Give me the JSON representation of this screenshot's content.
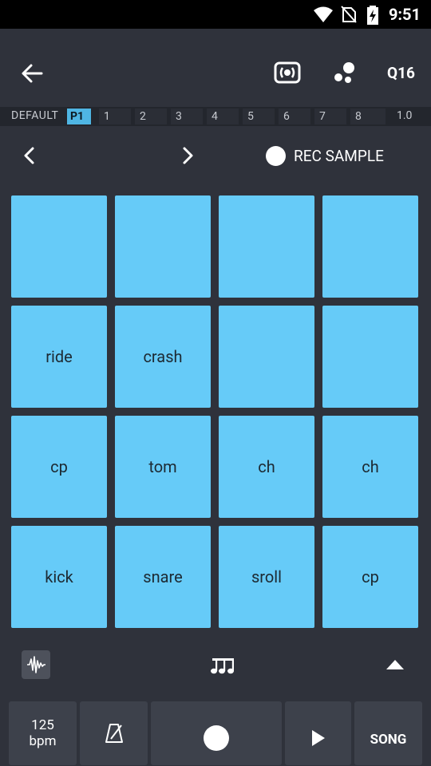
{
  "status_bar": {
    "time": "9:51"
  },
  "app_bar": {
    "quantize_label": "Q16"
  },
  "pattern_strip": {
    "default_label": "DEFAULT",
    "cells": [
      "P1",
      "1",
      "2",
      "3",
      "4",
      "5",
      "6",
      "7",
      "8"
    ],
    "active_cell": "P1",
    "speed": "1.0"
  },
  "page_nav": {
    "rec_sample_label": "REC SAMPLE"
  },
  "pads": {
    "row1": [
      "",
      "",
      "",
      ""
    ],
    "row2": [
      "ride",
      "crash",
      "",
      ""
    ],
    "row3": [
      "cp",
      "tom",
      "ch",
      "ch"
    ],
    "row4": [
      "kick",
      "snare",
      "sroll",
      "cp"
    ],
    "color": "#66cbf8"
  },
  "transport": {
    "bpm_value": "125",
    "bpm_unit": "bpm",
    "song_label": "SONG"
  },
  "colors": {
    "background": "#2f323b",
    "accent": "#4fb6e4",
    "pad": "#66cbf8"
  }
}
